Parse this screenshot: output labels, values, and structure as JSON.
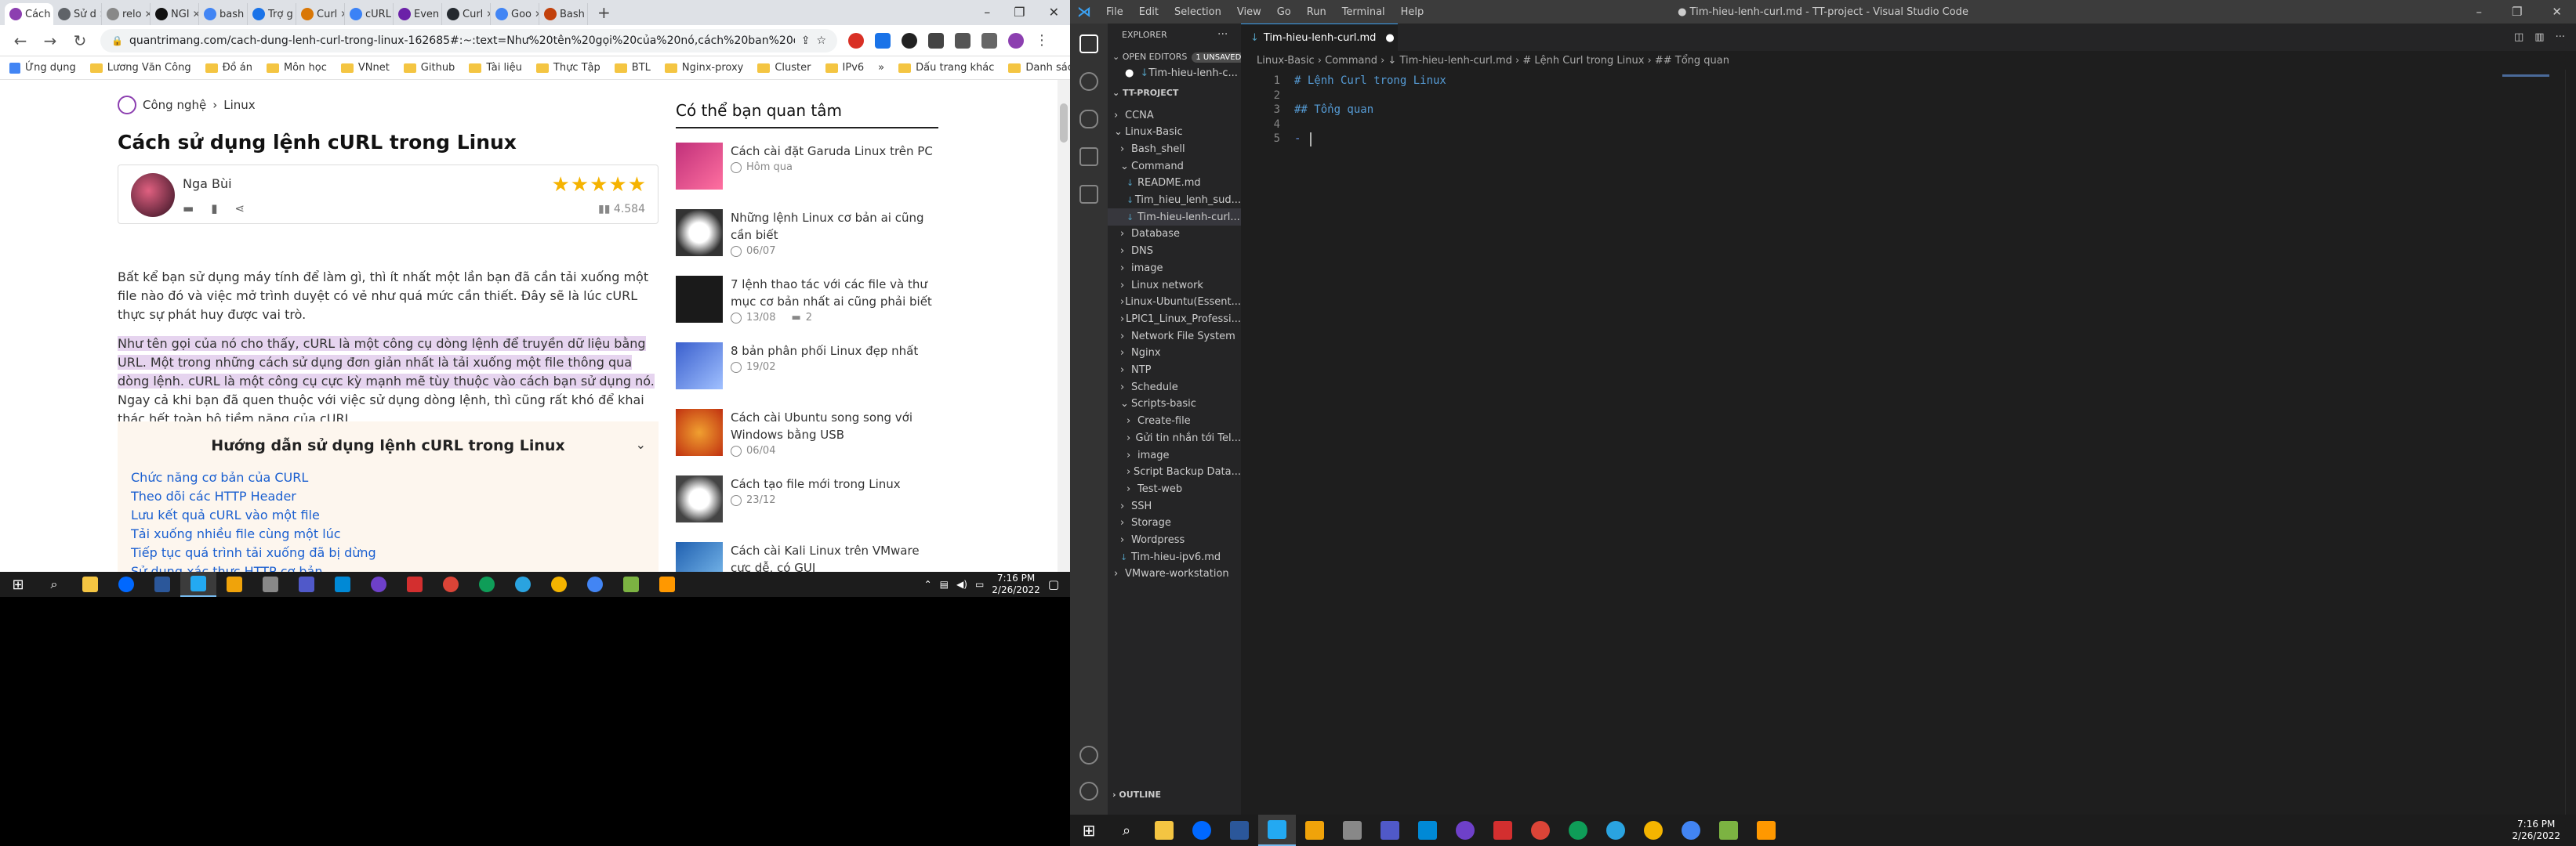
{
  "browser": {
    "tabs": [
      {
        "label": "Cách",
        "color": "#8c3fb0"
      },
      {
        "label": "Sử d",
        "color": "#5f6368"
      },
      {
        "label": "relo",
        "color": "#888888"
      },
      {
        "label": "NGI",
        "color": "#111111"
      },
      {
        "label": "bash",
        "color": "#4285f4"
      },
      {
        "label": "Trợ g",
        "color": "#1a73e8"
      },
      {
        "label": "Curl",
        "color": "#d97706"
      },
      {
        "label": "cURL",
        "color": "#3b82f6"
      },
      {
        "label": "Even",
        "color": "#6b21a8"
      },
      {
        "label": "Curl",
        "color": "#24292f"
      },
      {
        "label": "Goo",
        "color": "#4285f4"
      },
      {
        "label": "Bash",
        "color": "#c2410c"
      }
    ],
    "url": "quantrimang.com/cach-dung-lenh-curl-trong-linux-162685#:~:text=Như%20tên%20gọi%20của%20nó,cách%20ban%20đầu%20dùng%20nó",
    "bookmarks": [
      "Ứng dụng",
      "Lương Văn Công",
      "Đồ án",
      "Môn học",
      "VNnet",
      "Github",
      "Tài liệu",
      "Thực Tập",
      "BTL",
      "Nginx-proxy",
      "Cluster",
      "IPv6"
    ],
    "bookmarks_more": "»",
    "bookmarks_right": [
      "Dấu trang khác",
      "Danh sách đọc"
    ]
  },
  "article": {
    "breadcrumb": {
      "section": "Công nghệ",
      "sep": "›",
      "sub": "Linux"
    },
    "title": "Cách sử dụng lệnh cURL trong Linux",
    "author": "Nga Bùi",
    "stars": "★★★★★",
    "views": "4.584",
    "para1": "Bất kể bạn sử dụng máy tính để làm gì, thì ít nhất một lần bạn đã cần tải xuống một file nào đó và việc mở trình duyệt có vẻ như quá mức cần thiết. Đây sẽ là lúc cURL thực sự phát huy được vai trò.",
    "para2_hl": "Như tên gọi của nó cho thấy, cURL là một công cụ dòng lệnh để truyền dữ liệu bằng URL. Một trong những cách sử dụng đơn giản nhất là tải xuống một file thông qua dòng lệnh. cURL là một công cụ cực kỳ mạnh mẽ tùy thuộc vào cách bạn sử dụng nó.",
    "para2_rest": " Ngay cả khi bạn đã quen thuộc với việc sử dụng dòng lệnh, thì cũng rất khó để khai thác hết toàn bộ tiềm năng của cURL.",
    "toc_title": "Hướng dẫn sử dụng lệnh cURL trong Linux",
    "toc_items": [
      "Chức năng cơ bản của CURL",
      "Theo dõi các HTTP Header",
      "Lưu kết quả cURL vào một file",
      "Tải xuống nhiều file cùng một lúc",
      "Tiếp tục quá trình tải xuống đã bị dừng",
      "Sử dụng xác thực HTTP cơ bản"
    ]
  },
  "sidebar": {
    "title": "Có thể bạn quan tâm",
    "cards": [
      {
        "title": "Cách cài đặt Garuda Linux trên PC",
        "date": "Hôm qua",
        "comments": ""
      },
      {
        "title": "Những lệnh Linux cơ bản ai cũng cần biết",
        "date": "06/07",
        "comments": ""
      },
      {
        "title": "7 lệnh thao tác với các file và thư mục cơ bản nhất ai cũng phải biết",
        "date": "13/08",
        "comments": "2"
      },
      {
        "title": "8 bản phân phối Linux đẹp nhất",
        "date": "19/02",
        "comments": ""
      },
      {
        "title": "Cách cài Ubuntu song song với Windows bằng USB",
        "date": "06/04",
        "comments": ""
      },
      {
        "title": "Cách tạo file mới trong Linux",
        "date": "23/12",
        "comments": ""
      },
      {
        "title": "Cách cài Kali Linux trên VMware cực dễ, có GUI",
        "date": "",
        "comments": ""
      }
    ]
  },
  "taskbar_left": {
    "time": "7:16 PM",
    "date": "2/26/2022"
  },
  "vscode": {
    "menu": [
      "File",
      "Edit",
      "Selection",
      "View",
      "Go",
      "Run",
      "Terminal",
      "Help"
    ],
    "window_title": "● Tim-hieu-lenh-curl.md - TT-project - Visual Studio Code",
    "explorer_title": "EXPLORER",
    "explorer_more": "···",
    "open_editors": "OPEN EDITORS",
    "unsaved_badge": "1 UNSAVED",
    "open_file": "Tim-hieu-lenh-c...",
    "project": "TT-PROJECT",
    "tree": [
      {
        "label": "CCNA",
        "kind": "folder",
        "open": false,
        "depth": 0
      },
      {
        "label": "Linux-Basic",
        "kind": "folder",
        "open": true,
        "depth": 0
      },
      {
        "label": "Bash_shell",
        "kind": "folder",
        "open": false,
        "depth": 1
      },
      {
        "label": "Command",
        "kind": "folder",
        "open": true,
        "depth": 1
      },
      {
        "label": "README.md",
        "kind": "file",
        "depth": 2
      },
      {
        "label": "Tim_hieu_lenh_sud...",
        "kind": "file",
        "depth": 2
      },
      {
        "label": "Tim-hieu-lenh-curl...",
        "kind": "file",
        "depth": 2,
        "selected": true
      },
      {
        "label": "Database",
        "kind": "folder",
        "open": false,
        "depth": 1
      },
      {
        "label": "DNS",
        "kind": "folder",
        "open": false,
        "depth": 1
      },
      {
        "label": "image",
        "kind": "folder",
        "open": false,
        "depth": 1
      },
      {
        "label": "Linux network",
        "kind": "folder",
        "open": false,
        "depth": 1
      },
      {
        "label": "Linux-Ubuntu(Essent...",
        "kind": "folder",
        "open": false,
        "depth": 1
      },
      {
        "label": "LPIC1_Linux_Professi...",
        "kind": "folder",
        "open": false,
        "depth": 1
      },
      {
        "label": "Network File System",
        "kind": "folder",
        "open": false,
        "depth": 1
      },
      {
        "label": "Nginx",
        "kind": "folder",
        "open": false,
        "depth": 1
      },
      {
        "label": "NTP",
        "kind": "folder",
        "open": false,
        "depth": 1
      },
      {
        "label": "Schedule",
        "kind": "folder",
        "open": false,
        "depth": 1
      },
      {
        "label": "Scripts-basic",
        "kind": "folder",
        "open": true,
        "depth": 1
      },
      {
        "label": "Create-file",
        "kind": "folder",
        "open": false,
        "depth": 2
      },
      {
        "label": "Gửi tin nhắn tới Tel...",
        "kind": "folder",
        "open": false,
        "depth": 2
      },
      {
        "label": "image",
        "kind": "folder",
        "open": false,
        "depth": 2
      },
      {
        "label": "Script Backup Data...",
        "kind": "folder",
        "open": false,
        "depth": 2
      },
      {
        "label": "Test-web",
        "kind": "folder",
        "open": false,
        "depth": 2
      },
      {
        "label": "SSH",
        "kind": "folder",
        "open": false,
        "depth": 1
      },
      {
        "label": "Storage",
        "kind": "folder",
        "open": false,
        "depth": 1
      },
      {
        "label": "Wordpress",
        "kind": "folder",
        "open": false,
        "depth": 1
      },
      {
        "label": "Tim-hieu-ipv6.md",
        "kind": "file",
        "depth": 1
      },
      {
        "label": "VMware-workstation",
        "kind": "folder",
        "open": false,
        "depth": 0
      }
    ],
    "outline": "OUTLINE",
    "tab_label": "Tim-hieu-lenh-curl.md",
    "tab_dot": "●",
    "breadcrumbs": "Linux-Basic › Command › ↓ Tim-hieu-lenh-curl.md › # Lệnh Curl trong Linux › ## Tổng quan",
    "lines": [
      "1",
      "2",
      "3",
      "4",
      "5"
    ],
    "code": [
      "# Lệnh Curl trong Linux",
      "",
      "## Tổng quan",
      "",
      "- "
    ]
  },
  "taskbar_right": {
    "time": "7:16 PM",
    "date": "2/26/2022"
  }
}
